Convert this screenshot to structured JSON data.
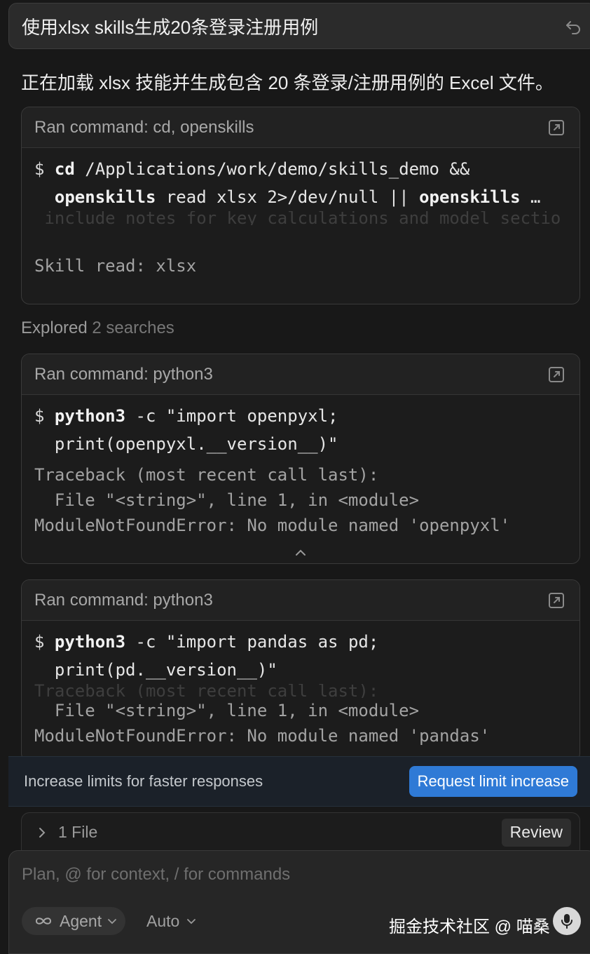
{
  "query": {
    "text": "使用xlsx skills生成20条登录注册用例"
  },
  "status_message": "正在加载 xlsx 技能并生成包含 20 条登录/注册用例的 Excel 文件。",
  "cards": [
    {
      "title": "Ran command: cd, openskills",
      "prompt": "$",
      "cmd_line1_bold": "cd",
      "cmd_line1_rest": " /Applications/work/demo/skills_demo &&",
      "cmd_line2_bold_a": "openskills",
      "cmd_line2_mid": " read xlsx 2>/dev/null || ",
      "cmd_line2_bold_b": "openskills",
      "cmd_line2_tail": " …",
      "faded_line": " include notes for key calculations and model sectio",
      "output": [
        "Skill read: xlsx"
      ]
    },
    {
      "title": "Ran command: python3",
      "prompt": "$",
      "cmd_line1_bold": "python3",
      "cmd_line1_rest": " -c \"import openpyxl;",
      "cmd_line2": "print(openpyxl.__version__)\"",
      "output": [
        "Traceback (most recent call last):",
        "  File \"<string>\", line 1, in <module>",
        "ModuleNotFoundError: No module named 'openpyxl'"
      ]
    },
    {
      "title": "Ran command: python3",
      "prompt": "$",
      "cmd_line1_bold": "python3",
      "cmd_line1_rest": " -c \"import pandas as pd;",
      "cmd_line2": "print(pd.__version__)\"",
      "faded_line": "Traceback (most recent call last):",
      "output": [
        "  File \"<string>\", line 1, in <module>",
        "ModuleNotFoundError: No module named 'pandas'"
      ]
    }
  ],
  "explored": {
    "label": "Explored",
    "count": "2 searches"
  },
  "banner": {
    "text": "Increase limits for faster responses",
    "button": "Request limit increase"
  },
  "files": {
    "label": "1 File",
    "review": "Review"
  },
  "composer": {
    "placeholder": "Plan, @ for context, / for commands",
    "mode": "Agent",
    "model": "Auto",
    "watermark": "掘金技术社区 @ 喵桑"
  },
  "colors": {
    "accent": "#2f7ad6",
    "background": "#181818"
  }
}
